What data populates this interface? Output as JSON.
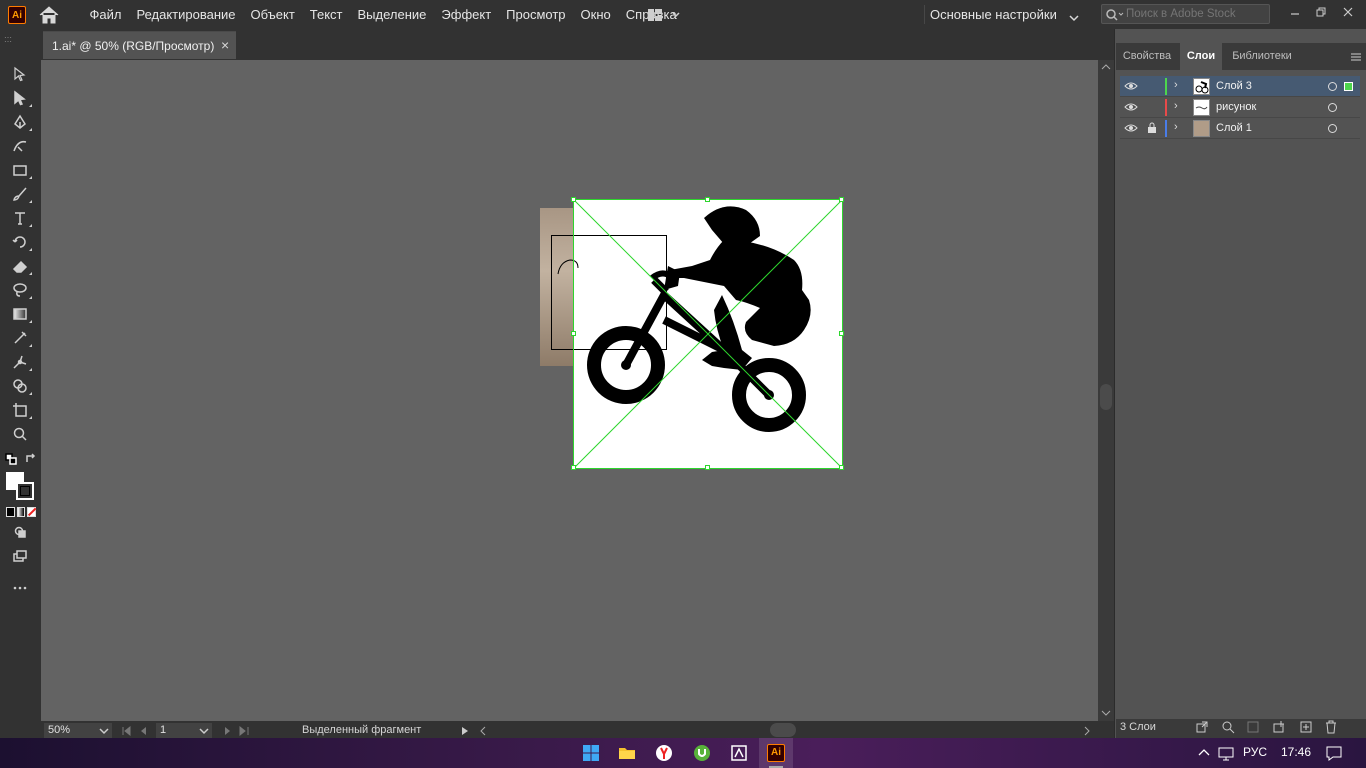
{
  "app": {
    "logo": "Ai"
  },
  "menu": {
    "items": [
      "Файл",
      "Редактирование",
      "Объект",
      "Текст",
      "Выделение",
      "Эффект",
      "Просмотр",
      "Окно",
      "Справка"
    ]
  },
  "workspace": {
    "label": "Основные настройки"
  },
  "search": {
    "placeholder": "Поиск в Adobe Stock"
  },
  "document_tab": {
    "title": "1.ai* @ 50% (RGB/Просмотр)",
    "close": "×"
  },
  "status": {
    "zoom": "50%",
    "page": "1",
    "info": "Выделенный фрагмент"
  },
  "panel": {
    "tabs": [
      "Свойства",
      "Слои",
      "Библиотеки"
    ],
    "active_tab": "Слои",
    "layers": [
      {
        "name": "Слой 3",
        "color": "#4dd64d",
        "selected": true,
        "locked": false,
        "visible": true
      },
      {
        "name": "рисунок",
        "color": "#e84a4a",
        "selected": false,
        "locked": false,
        "visible": true
      },
      {
        "name": "Слой 1",
        "color": "#4a7de8",
        "selected": false,
        "locked": true,
        "visible": true
      }
    ],
    "layer_count": "3 Слои"
  },
  "taskbar": {
    "language": "РУС",
    "time": "17:46"
  },
  "icons": {
    "toolbar": [
      "selection-tool-icon",
      "direct-selection-tool-icon",
      "pen-tool-icon",
      "curvature-tool-icon",
      "rectangle-tool-icon",
      "paintbrush-tool-icon",
      "type-tool-icon",
      "rotate-tool-icon",
      "eraser-tool-icon",
      "lasso-tool-icon",
      "gradient-tool-icon",
      "eyedropper-tool-icon",
      "puppet-warp-icon",
      "shape-builder-icon",
      "artboard-tool-icon",
      "zoom-tool-icon"
    ]
  },
  "colors": {
    "selection": "#2dd62d",
    "accent": "#ff9a00"
  }
}
